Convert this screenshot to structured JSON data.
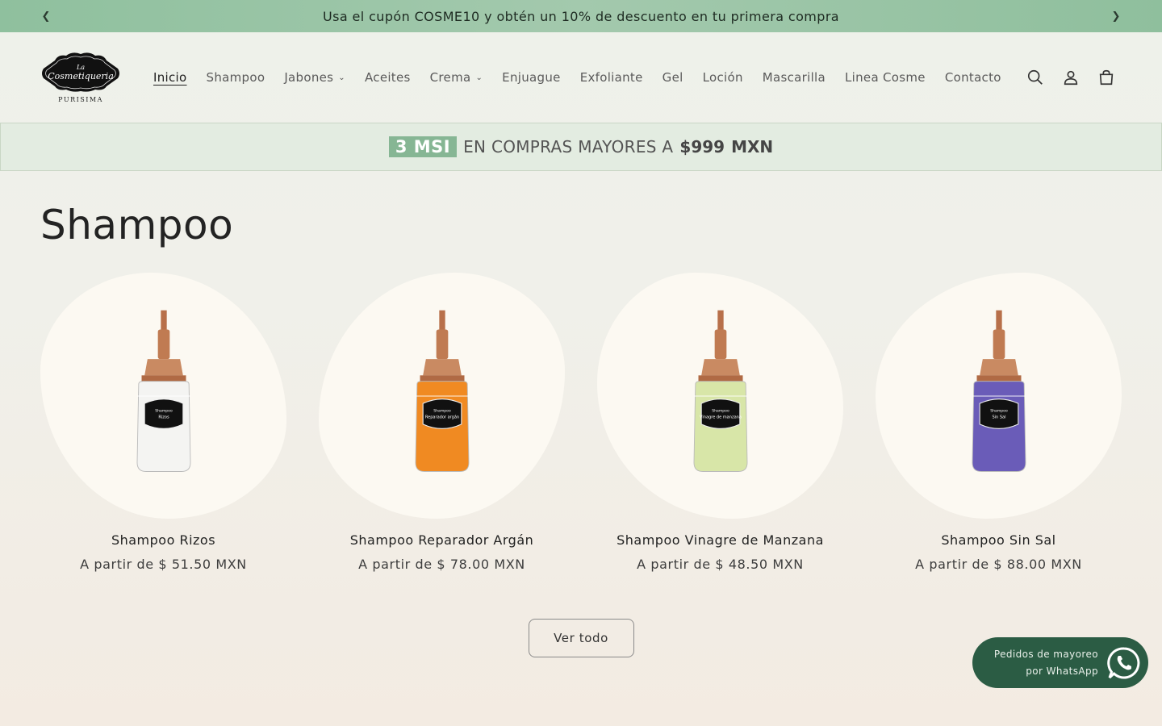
{
  "announcement": {
    "text": "Usa el cupón COSME10 y obtén un 10% de descuento en tu primera compra",
    "prev_icon": "chevron-left-icon",
    "next_icon": "chevron-right-icon"
  },
  "brand": {
    "logo_line1": "La",
    "logo_line2": "Cosmetiqueria",
    "logo_line3": "PURISIMA"
  },
  "nav": {
    "items": [
      {
        "label": "Inicio",
        "active": true
      },
      {
        "label": "Shampoo"
      },
      {
        "label": "Jabones",
        "dropdown": true
      },
      {
        "label": "Aceites"
      },
      {
        "label": "Crema",
        "dropdown": true
      },
      {
        "label": "Enjuague"
      },
      {
        "label": "Exfoliante"
      },
      {
        "label": "Gel"
      },
      {
        "label": "Loción"
      },
      {
        "label": "Mascarilla"
      },
      {
        "label": "Linea Cosme"
      },
      {
        "label": "Contacto"
      }
    ]
  },
  "msi_banner": {
    "badge": "3 MSI",
    "text": "EN COMPRAS MAYORES A",
    "amount": "$999",
    "currency": "MXN"
  },
  "section": {
    "title": "Shampoo",
    "view_all": "Ver todo"
  },
  "products": [
    {
      "name": "Shampoo Rizos",
      "price": "A partir de $ 51.50 MXN",
      "label": "Rizos",
      "liquid": "#f4f4f2"
    },
    {
      "name": "Shampoo Reparador Argán",
      "price": "A partir de $ 78.00 MXN",
      "label": "Reparador argán",
      "liquid": "#f08a22"
    },
    {
      "name": "Shampoo Vinagre de Manzana",
      "price": "A partir de $ 48.50 MXN",
      "label": "Vinagre de manzana",
      "liquid": "#d8e6a8"
    },
    {
      "name": "Shampoo Sin Sal",
      "price": "A partir de $ 88.00 MXN",
      "label": "Sin Sal",
      "liquid": "#6a5cb8"
    }
  ],
  "whatsapp": {
    "line1": "Pedidos de mayoreo",
    "line2": "por WhatsApp"
  },
  "colors": {
    "announcement_bg": "#a3c9ad",
    "msi_badge": "#86b694",
    "whatsapp_bg": "#2b5c44"
  }
}
